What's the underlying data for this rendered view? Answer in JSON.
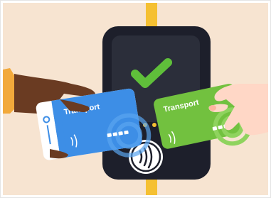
{
  "illustration": {
    "blue_card": {
      "label": "Transport",
      "color": "#3d8ee6",
      "stripe_color": "#ffffff"
    },
    "green_card": {
      "label": "Transport",
      "color": "#72c13f"
    },
    "validator": {
      "body_color": "#1d1f2b",
      "screen_color": "#2b2e3a",
      "check_color": "#5fbf3a",
      "reader_icon": "contactless-icon"
    },
    "colors": {
      "background": "#f7e4d1",
      "pole": "#f5c032",
      "dark_skin": "#6a3b22",
      "light_skin": "#ffd7c6",
      "sleeve": "#f2a93b",
      "border": "#e4e4e4"
    }
  }
}
